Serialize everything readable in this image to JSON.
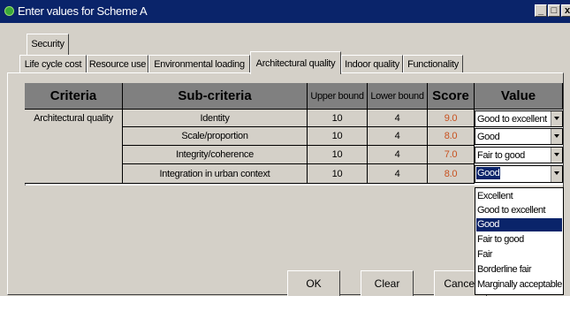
{
  "window": {
    "title": "Enter values for Scheme A",
    "controls": {
      "minimize": "_",
      "maximize": "□",
      "close": "x"
    }
  },
  "tabs_row1": [
    {
      "label": "Security"
    }
  ],
  "tabs_row2": [
    {
      "label": "Life cycle cost"
    },
    {
      "label": "Resource use"
    },
    {
      "label": "Environmental loading"
    },
    {
      "label": "Architectural quality",
      "active": true
    },
    {
      "label": "Indoor quality"
    },
    {
      "label": "Functionality"
    }
  ],
  "table": {
    "headers": {
      "criteria": "Criteria",
      "sub_criteria": "Sub-criteria",
      "upper": "Upper bound",
      "lower": "Lower bound",
      "score": "Score",
      "value": "Value"
    },
    "criteria": "Architectural quality",
    "rows": [
      {
        "sub": "Identity",
        "upper": "10",
        "lower": "4",
        "score": "9.0",
        "value": "Good to excellent"
      },
      {
        "sub": "Scale/proportion",
        "upper": "10",
        "lower": "4",
        "score": "8.0",
        "value": "Good"
      },
      {
        "sub": "Integrity/coherence",
        "upper": "10",
        "lower": "4",
        "score": "7.0",
        "value": "Fair to good"
      },
      {
        "sub": "Integration in urban context",
        "upper": "10",
        "lower": "4",
        "score": "8.0",
        "value": "Good",
        "focused": true
      }
    ]
  },
  "dropdown": {
    "options": [
      "Excellent",
      "Good to excellent",
      "Good",
      "Fair to good",
      "Fair",
      "Borderline fair",
      "Marginally acceptable"
    ],
    "selected": "Good"
  },
  "buttons": {
    "ok": "OK",
    "clear": "Clear",
    "cancel": "Cancel"
  },
  "colors": {
    "titlebar": "#0a246a",
    "face": "#d4d0c8",
    "header": "#808080",
    "score": "#c8501e",
    "selection": "#0a246a"
  },
  "icons": {
    "app": "green-orb-icon",
    "combo": "chevron-down-icon"
  }
}
